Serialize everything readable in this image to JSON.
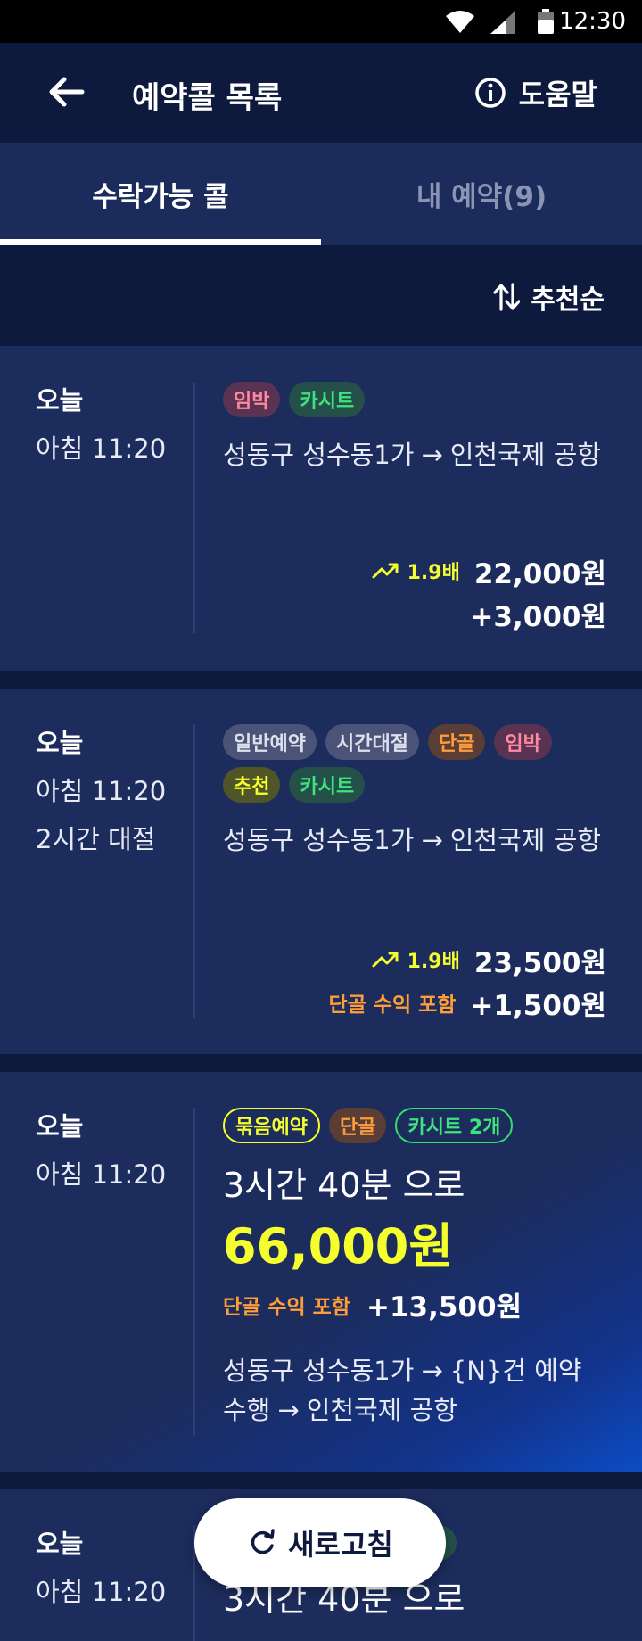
{
  "status_bar": {
    "time": "12:30"
  },
  "app_bar": {
    "title": "예약콜 목록",
    "help_label": "도움말"
  },
  "tabs": [
    {
      "label": "수락가능 콜",
      "active": true
    },
    {
      "label": "내 예약(9)",
      "active": false
    }
  ],
  "sort": {
    "label": "추천순"
  },
  "cards": [
    {
      "day": "오늘",
      "time": "아침 11:20",
      "badges": [
        "임박",
        "카시트"
      ],
      "route_from": "성동구 성수동1가",
      "route_to": "인천국제 공항",
      "multiplier": "1.9배",
      "price": "22,000원",
      "bonus": "+3,000원"
    },
    {
      "day": "오늘",
      "time": "아침 11:20",
      "sub": "2시간 대절",
      "badges": [
        "일반예약",
        "시간대절",
        "단골",
        "임박",
        "추천",
        "카시트"
      ],
      "route_from": "성동구 성수동1가",
      "route_to": "인천국제 공항",
      "multiplier": "1.9배",
      "price": "23,500원",
      "included_label": "단골 수익 포함",
      "bonus": "+1,500원"
    },
    {
      "day": "오늘",
      "time": "아침 11:20",
      "badges": [
        "묶음예약",
        "단골",
        "카시트 2개"
      ],
      "duration": "3시간 40분 으로",
      "price": "66,000원",
      "included_label": "단골 수익 포함",
      "bonus": "+13,500원",
      "route_from": "성동구 성수동1가",
      "route_mid": "{N}건 예약 수행",
      "route_to": "인천국제 공항"
    },
    {
      "day": "오늘",
      "time": "아침 11:20",
      "duration": "3시간 40분 으로"
    }
  ],
  "refresh_button": {
    "label": "새로고침"
  },
  "colors": {
    "background": "#0d1a3d",
    "card": "#1c2c5c",
    "accent_yellow": "#f6ff2e",
    "accent_orange": "#ff9d3a"
  }
}
